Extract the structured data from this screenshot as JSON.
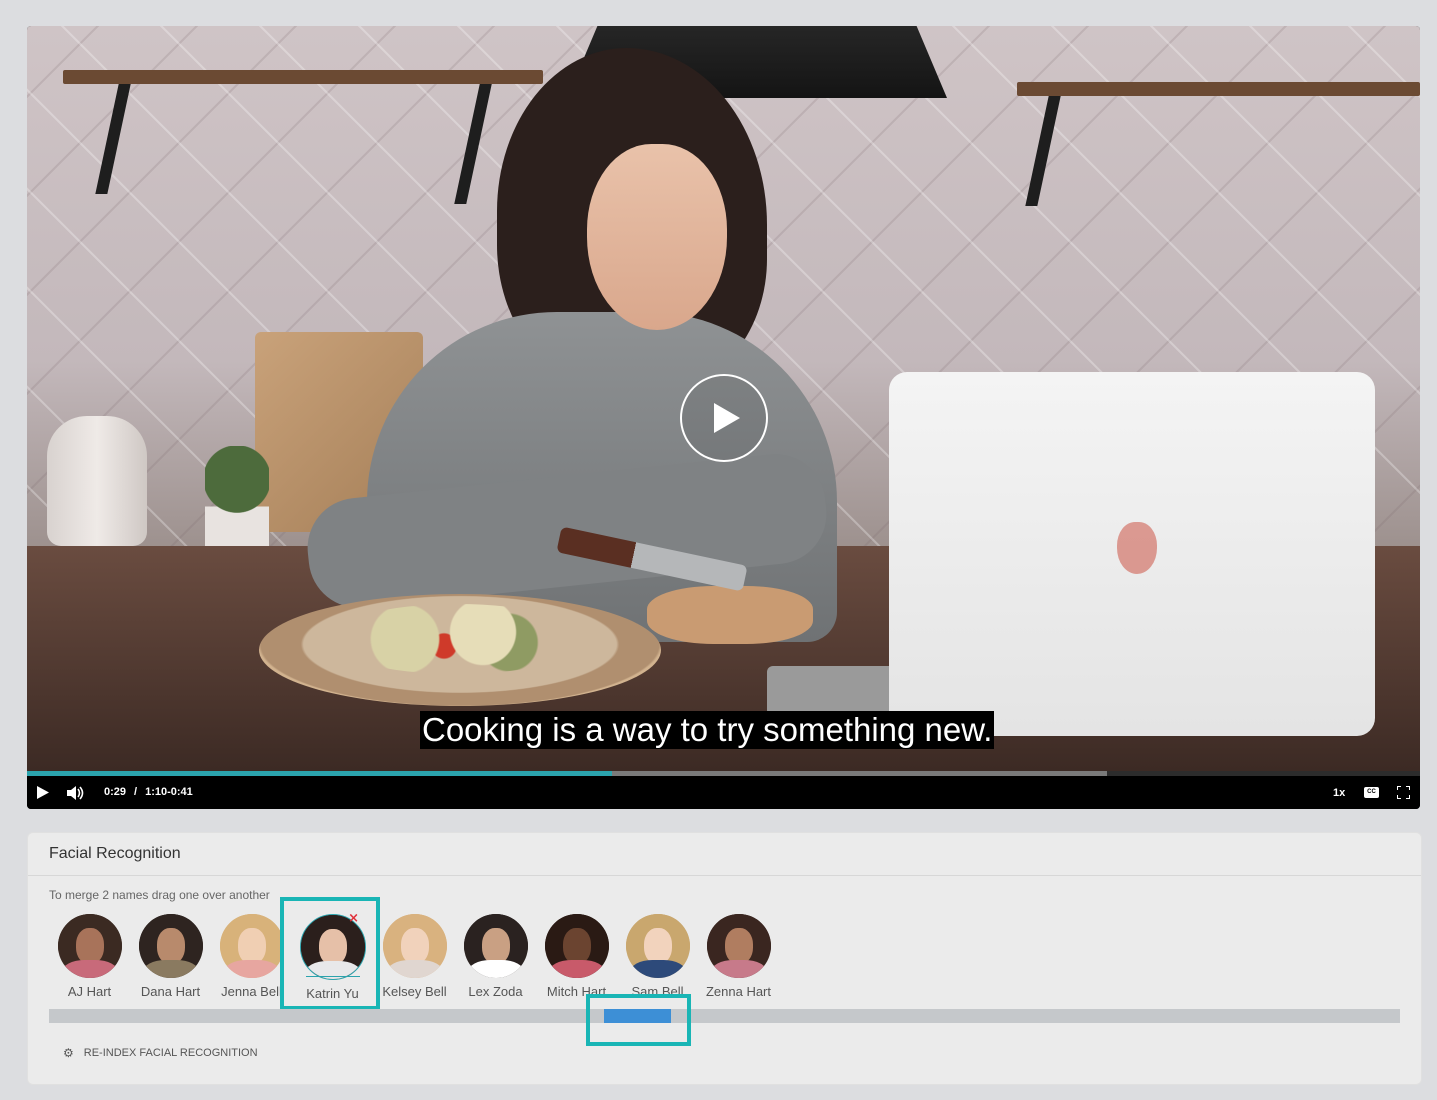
{
  "video": {
    "caption": "Cooking is a way to try something new.",
    "current_time": "0:29",
    "time_separator": "/",
    "range": "1:10-0:41",
    "speed": "1x",
    "cc_label": "CC",
    "played_fraction": 0.42,
    "buffered_fraction": 0.775,
    "accent_color": "#2ba3ad"
  },
  "facial_recognition": {
    "title": "Facial Recognition",
    "hint": "To merge 2 names drag one over another",
    "people": [
      {
        "name": "AJ Hart"
      },
      {
        "name": "Dana Hart"
      },
      {
        "name": "Jenna Bell"
      },
      {
        "name": "Katrin Yu",
        "selected": true
      },
      {
        "name": "Kelsey Bell"
      },
      {
        "name": "Lex Zoda"
      },
      {
        "name": "Mitch Hart"
      },
      {
        "name": "Sam Bell"
      },
      {
        "name": "Zenna Hart"
      }
    ],
    "remove_icon": "×",
    "reindex_label": "RE-INDEX FACIAL RECOGNITION",
    "highlight_color": "#19b5b5",
    "scroll_thumb_color": "#3d8fd6"
  }
}
